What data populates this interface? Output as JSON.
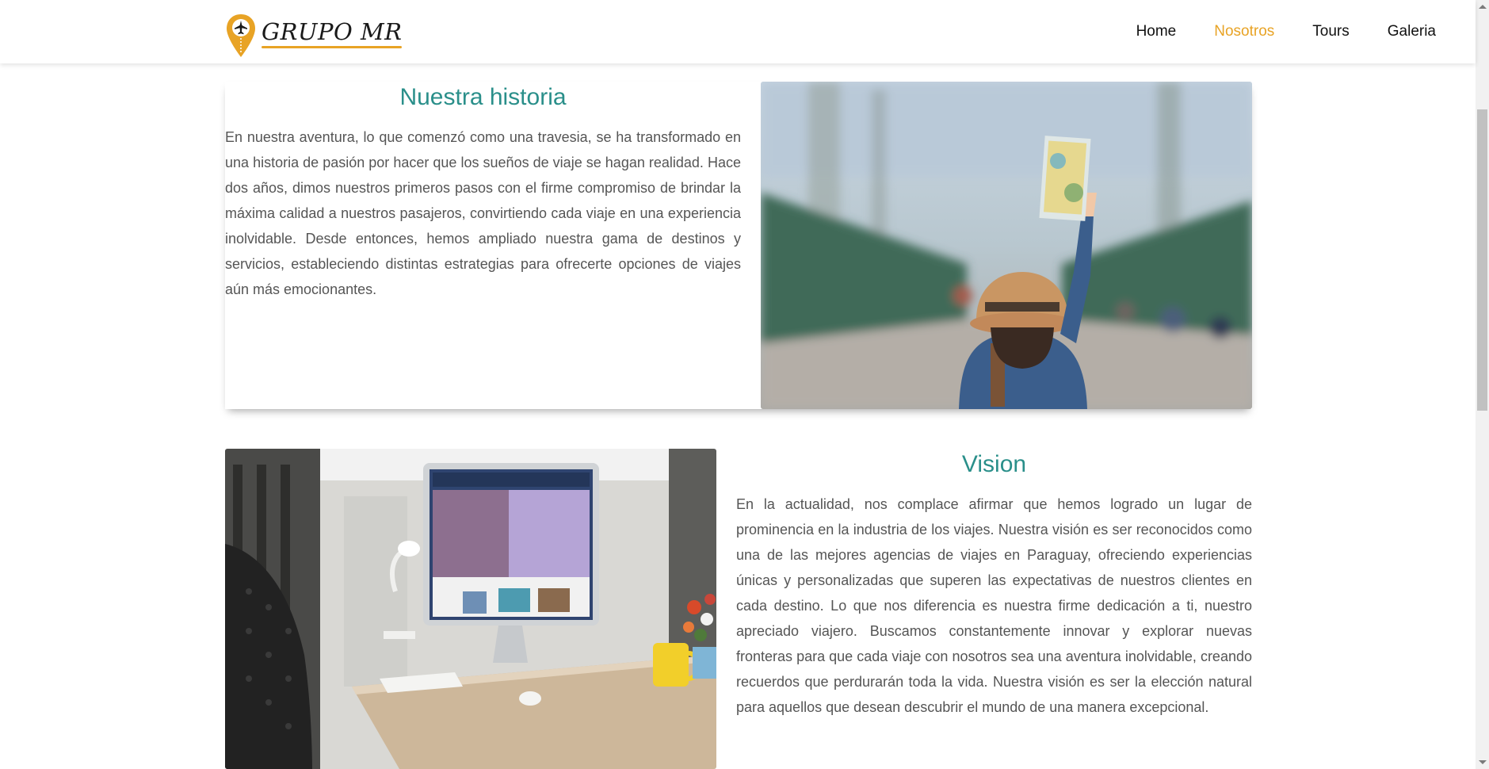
{
  "brand": {
    "name": "GRUPO MR",
    "accent": "#e8a325",
    "title_color": "#2a8f8a"
  },
  "nav": {
    "items": [
      {
        "label": "Home"
      },
      {
        "label": "Nosotros",
        "active": true
      },
      {
        "label": "Tours"
      },
      {
        "label": "Galeria"
      }
    ]
  },
  "history": {
    "title": "Nuestra historia",
    "body": "En nuestra aventura, lo que comenzó como una travesia, se ha transformado en una historia de pasión por hacer que los sueños de viaje se hagan realidad. Hace dos años, dimos nuestros primeros pasos con el firme compromiso de brindar la máxima calidad a nuestros pasajeros, convirtiendo cada viaje en una experiencia inolvidable. Desde entonces, hemos ampliado nuestra gama de destinos y servicios, estableciendo distintas estrategias para ofrecerte opciones de viajes aún más emocionantes."
  },
  "vision": {
    "title": "Vision",
    "body": "En la actualidad, nos complace afirmar que hemos logrado un lugar de prominencia en la industria de los viajes. Nuestra visión es ser reconocidos como una de las mejores agencias de viajes en Paraguay, ofreciendo experiencias únicas y personalizadas que superen las expectativas de nuestros clientes en cada destino. Lo que nos diferencia es nuestra firme dedicación a ti, nuestro apreciado viajero. Buscamos constantemente innovar y explorar nuevas fronteras para que cada viaje con nosotros sea una aventura inolvidable, creando recuerdos que perdurarán toda la vida. Nuestra visión es ser la elección natural para aquellos que desean descubrir el mundo de una manera excepcional."
  },
  "images": [
    {
      "icon": "traveler-with-map-photo"
    },
    {
      "icon": "travel-agency-desk-computer-photo"
    }
  ]
}
